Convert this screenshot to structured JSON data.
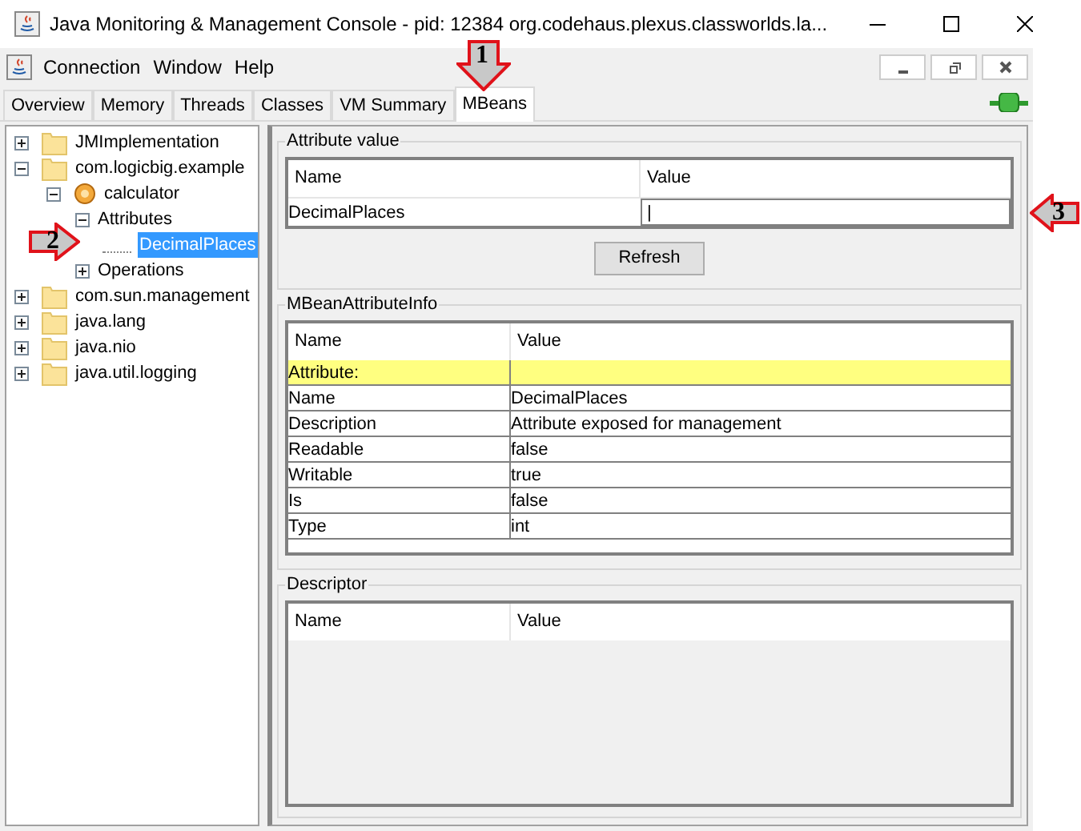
{
  "window": {
    "title": "Java Monitoring & Management Console - pid: 12384 org.codehaus.plexus.classworlds.la..."
  },
  "menu": [
    "Connection",
    "Window",
    "Help"
  ],
  "tabs": [
    {
      "label": "Overview",
      "selected": false
    },
    {
      "label": "Memory",
      "selected": false
    },
    {
      "label": "Threads",
      "selected": false
    },
    {
      "label": "Classes",
      "selected": false
    },
    {
      "label": "VM Summary",
      "selected": false
    },
    {
      "label": "MBeans",
      "selected": true
    }
  ],
  "tree": [
    {
      "label": "JMImplementation",
      "kind": "folder",
      "expanded": false,
      "selected": false
    },
    {
      "label": "com.logicbig.example",
      "kind": "folder",
      "expanded": true,
      "selected": false,
      "children": [
        {
          "label": "calculator",
          "kind": "bean",
          "expanded": true,
          "selected": false,
          "children": [
            {
              "label": "Attributes",
              "kind": "node",
              "expanded": true,
              "selected": false,
              "children": [
                {
                  "label": "DecimalPlaces",
                  "kind": "leaf",
                  "selected": true
                }
              ]
            },
            {
              "label": "Operations",
              "kind": "node",
              "expanded": false,
              "selected": false
            }
          ]
        }
      ]
    },
    {
      "label": "com.sun.management",
      "kind": "folder",
      "expanded": false,
      "selected": false
    },
    {
      "label": "java.lang",
      "kind": "folder",
      "expanded": false,
      "selected": false
    },
    {
      "label": "java.nio",
      "kind": "folder",
      "expanded": false,
      "selected": false
    },
    {
      "label": "java.util.logging",
      "kind": "folder",
      "expanded": false,
      "selected": false
    }
  ],
  "attribute_value": {
    "title": "Attribute value",
    "columns": [
      "Name",
      "Value"
    ],
    "row": {
      "name": "DecimalPlaces",
      "value": "|"
    },
    "button": "Refresh"
  },
  "info": {
    "title": "MBeanAttributeInfo",
    "columns": [
      "Name",
      "Value"
    ],
    "rows": [
      {
        "name": "Attribute:",
        "value": "",
        "highlighted": true
      },
      {
        "name": "Name",
        "value": "DecimalPlaces",
        "highlighted": false
      },
      {
        "name": "Description",
        "value": "Attribute exposed for management",
        "highlighted": false
      },
      {
        "name": "Readable",
        "value": "false",
        "highlighted": false
      },
      {
        "name": "Writable",
        "value": "true",
        "highlighted": false
      },
      {
        "name": "Is",
        "value": "false",
        "highlighted": false
      },
      {
        "name": "Type",
        "value": "int",
        "highlighted": false
      }
    ]
  },
  "descriptor": {
    "title": "Descriptor",
    "columns": [
      "Name",
      "Value"
    ]
  },
  "callouts": [
    {
      "label": "1",
      "kind": "down"
    },
    {
      "label": "2",
      "kind": "right"
    },
    {
      "label": "3",
      "kind": "left"
    }
  ]
}
